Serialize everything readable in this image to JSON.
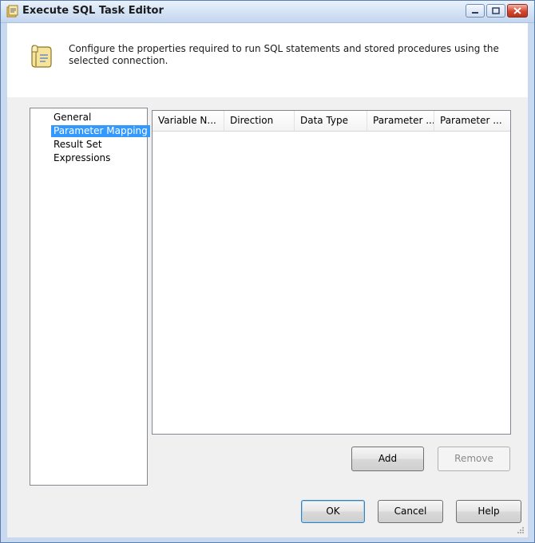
{
  "window": {
    "title": "Execute SQL Task Editor",
    "icon": "sql-task-icon"
  },
  "header": {
    "icon": "scroll-icon",
    "description": "Configure the properties required to run SQL statements and stored procedures using the selected connection."
  },
  "nav": {
    "items": [
      {
        "label": "General",
        "selected": false
      },
      {
        "label": "Parameter Mapping",
        "selected": true
      },
      {
        "label": "Result Set",
        "selected": false
      },
      {
        "label": "Expressions",
        "selected": false
      }
    ]
  },
  "grid": {
    "columns": [
      "Variable N...",
      "Direction",
      "Data Type",
      "Parameter ...",
      "Parameter ..."
    ],
    "rows": []
  },
  "buttons": {
    "add": "Add",
    "remove": "Remove",
    "ok": "OK",
    "cancel": "Cancel",
    "help": "Help"
  },
  "colors": {
    "selection": "#3399ff",
    "window_frame": "#c9daf0",
    "close_button": "#d2462d"
  }
}
